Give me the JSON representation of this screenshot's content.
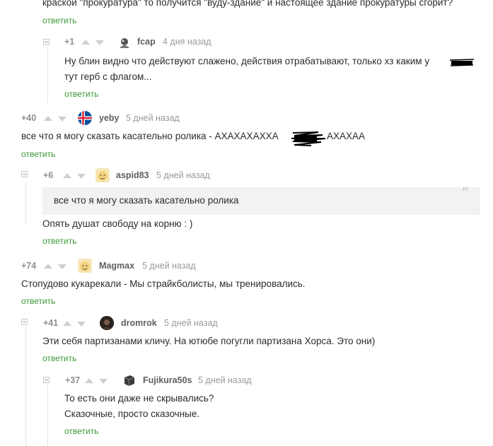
{
  "top_fragment": {
    "text": "краской \"прокуратура\" то получится \"вуду-здание\" и настоящее здание прокуратуры сгорит?"
  },
  "reply_label": "ответить",
  "comments": [
    {
      "score": "+1",
      "user": "fcap",
      "time": "4 дня назад",
      "lines": [
        "Ну блин видно что действуют слажено, действия отрабатывают, только хз каким у",
        "тут герб с флагом..."
      ]
    },
    {
      "score": "+40",
      "user": "yeby",
      "time": "5 дней назад",
      "lines": [
        "все что я могу сказать касательно ролика - АХАХАХАХХА",
        "АХАХАА"
      ]
    },
    {
      "score": "+6",
      "user": "aspid83",
      "time": "5 дней назад",
      "quote": "все что я могу сказать касательно ролика",
      "lines": [
        "Опять душат свободу на корню : )"
      ]
    },
    {
      "score": "+74",
      "user": "Magmax",
      "time": "5 дней назад",
      "lines": [
        "Стопудово кукарекали - Мы страйкболисты, мы тренировались."
      ]
    },
    {
      "score": "+41",
      "user": "dromrok",
      "time": "5 дней назад",
      "lines": [
        "Эти себя партизанами кличу. На ютюбе погугли партизана Хорса. Это они)"
      ]
    },
    {
      "score": "+37",
      "user": "Fujikura50s",
      "time": "5 дней назад",
      "lines": [
        "То есть они даже не скрывались?",
        "Сказочные, просто сказочные."
      ]
    }
  ],
  "colors": {
    "reply": "#3d9a37",
    "score": "#8f8f8f",
    "username": "#606060",
    "time": "#9a9a9a"
  }
}
